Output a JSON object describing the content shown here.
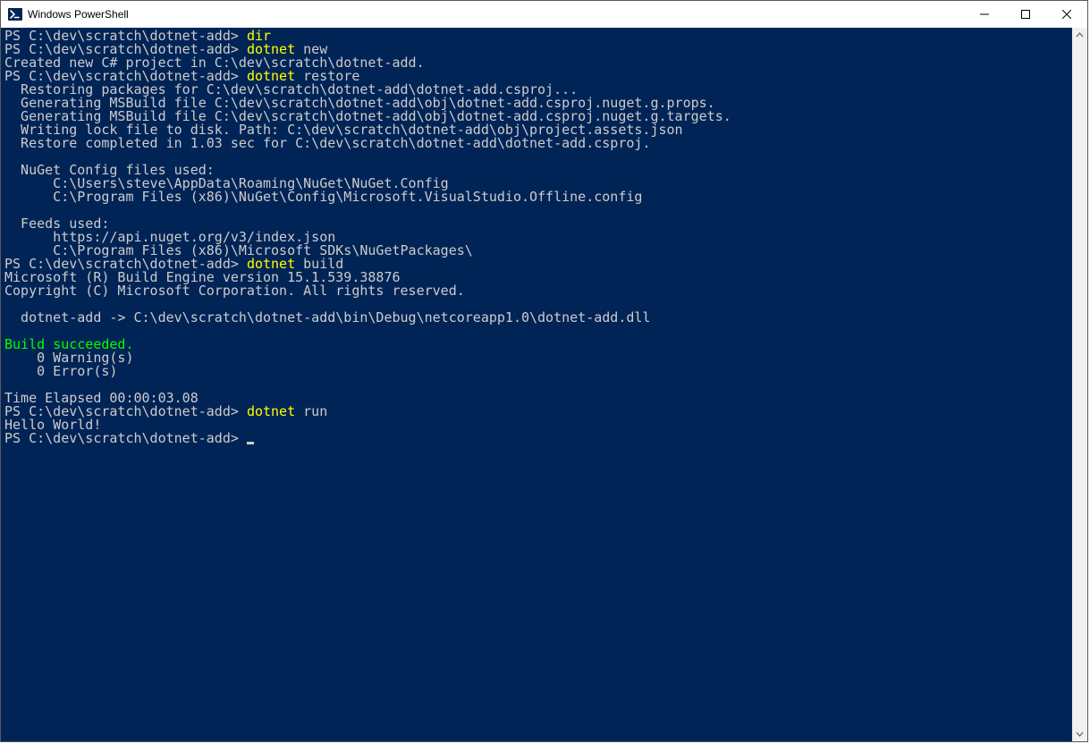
{
  "window": {
    "title": "Windows PowerShell"
  },
  "prompt": "PS C:\\dev\\scratch\\dotnet-add>",
  "lines": {
    "l1_prompt": "PS C:\\dev\\scratch\\dotnet-add> ",
    "l1_cmd": "dir",
    "l2_prompt": "PS C:\\dev\\scratch\\dotnet-add> ",
    "l2_cmd": "dotnet ",
    "l2_arg": "new",
    "l3": "Created new C# project in C:\\dev\\scratch\\dotnet-add.",
    "l4_prompt": "PS C:\\dev\\scratch\\dotnet-add> ",
    "l4_cmd": "dotnet ",
    "l4_arg": "restore",
    "l5": "  Restoring packages for C:\\dev\\scratch\\dotnet-add\\dotnet-add.csproj...",
    "l6": "  Generating MSBuild file C:\\dev\\scratch\\dotnet-add\\obj\\dotnet-add.csproj.nuget.g.props.",
    "l7": "  Generating MSBuild file C:\\dev\\scratch\\dotnet-add\\obj\\dotnet-add.csproj.nuget.g.targets.",
    "l8": "  Writing lock file to disk. Path: C:\\dev\\scratch\\dotnet-add\\obj\\project.assets.json",
    "l9": "  Restore completed in 1.03 sec for C:\\dev\\scratch\\dotnet-add\\dotnet-add.csproj.",
    "l10": "",
    "l11": "  NuGet Config files used:",
    "l12": "      C:\\Users\\steve\\AppData\\Roaming\\NuGet\\NuGet.Config",
    "l13": "      C:\\Program Files (x86)\\NuGet\\Config\\Microsoft.VisualStudio.Offline.config",
    "l14": "",
    "l15": "  Feeds used:",
    "l16": "      https://api.nuget.org/v3/index.json",
    "l17": "      C:\\Program Files (x86)\\Microsoft SDKs\\NuGetPackages\\",
    "l18_prompt": "PS C:\\dev\\scratch\\dotnet-add> ",
    "l18_cmd": "dotnet ",
    "l18_arg": "build",
    "l19": "Microsoft (R) Build Engine version 15.1.539.38876",
    "l20": "Copyright (C) Microsoft Corporation. All rights reserved.",
    "l21": "",
    "l22": "  dotnet-add -> C:\\dev\\scratch\\dotnet-add\\bin\\Debug\\netcoreapp1.0\\dotnet-add.dll",
    "l23": "",
    "l24_green": "Build succeeded.",
    "l25": "    0 Warning(s)",
    "l26": "    0 Error(s)",
    "l27": "",
    "l28": "Time Elapsed 00:00:03.08",
    "l29_prompt": "PS C:\\dev\\scratch\\dotnet-add> ",
    "l29_cmd": "dotnet ",
    "l29_arg": "run",
    "l30": "Hello World!",
    "l31_prompt": "PS C:\\dev\\scratch\\dotnet-add>"
  }
}
